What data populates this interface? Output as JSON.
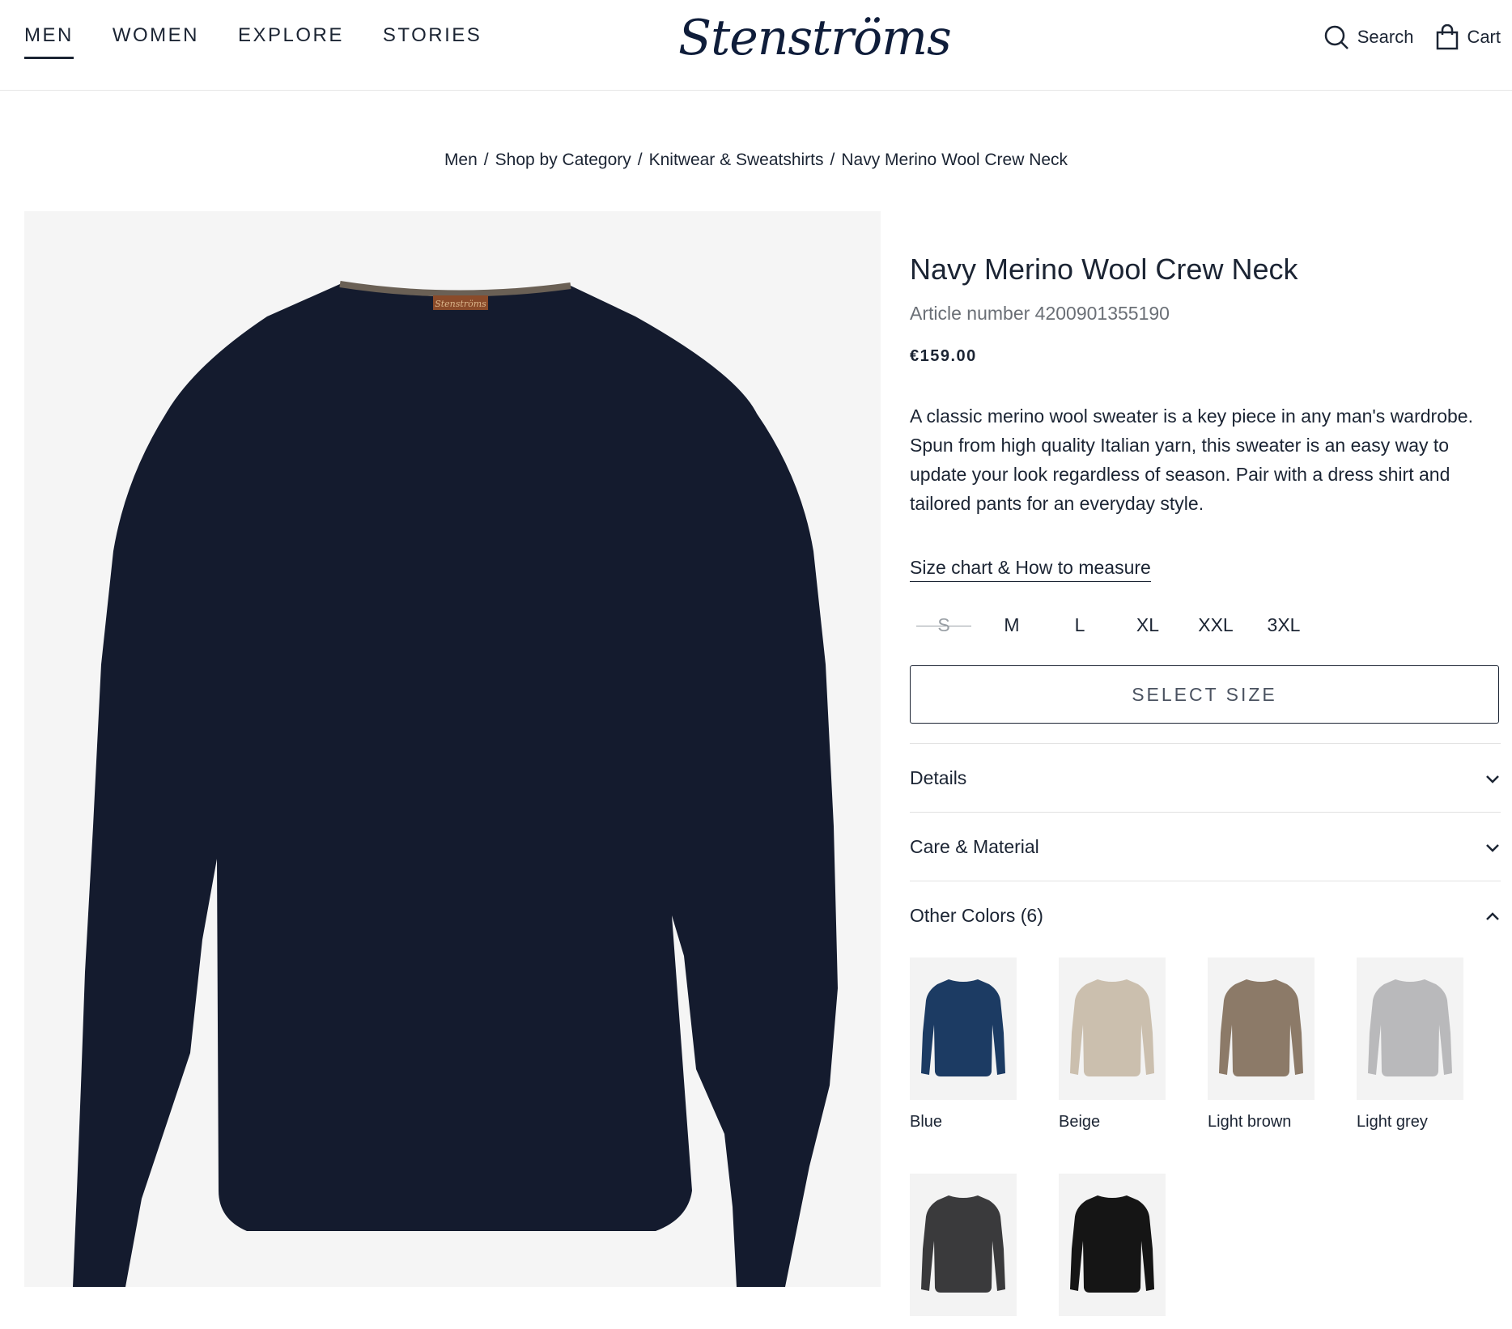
{
  "nav": {
    "items": [
      "MEN",
      "WOMEN",
      "EXPLORE",
      "STORIES"
    ]
  },
  "logo": "Stenströms",
  "header": {
    "search_label": "Search",
    "cart_label": "Cart"
  },
  "breadcrumb": [
    "Men",
    "Shop by Category",
    "Knitwear & Sweatshirts",
    "Navy Merino Wool Crew Neck"
  ],
  "product": {
    "title": "Navy Merino Wool Crew Neck",
    "article": "Article number 4200901355190",
    "price": "€159.00",
    "description": "A classic merino wool sweater is a key piece in any man's wardrobe. Spun from high quality Italian yarn, this sweater is an easy way to update your look regardless of season. Pair with a dress shirt and tailored pants for an everyday style.",
    "size_chart_link": "Size chart & How to measure",
    "sizes": [
      "S",
      "M",
      "L",
      "XL",
      "XXL",
      "3XL"
    ],
    "select_size_label": "SELECT SIZE",
    "label_tag": "Stenströms"
  },
  "accordion": {
    "details": "Details",
    "care": "Care & Material",
    "other_colors": "Other Colors (6)"
  },
  "colors": [
    {
      "name": "Blue",
      "hex": "#1c3b63"
    },
    {
      "name": "Beige",
      "hex": "#cbbfae"
    },
    {
      "name": "Light brown",
      "hex": "#8c7a68"
    },
    {
      "name": "Light grey",
      "hex": "#b9b9bb"
    },
    {
      "name": "",
      "hex": "#3a3a3c"
    },
    {
      "name": "",
      "hex": "#151515"
    }
  ],
  "theme": {
    "sweater_color": "#141b2e",
    "text_color": "#1b2433",
    "image_bg": "#f5f5f5"
  }
}
